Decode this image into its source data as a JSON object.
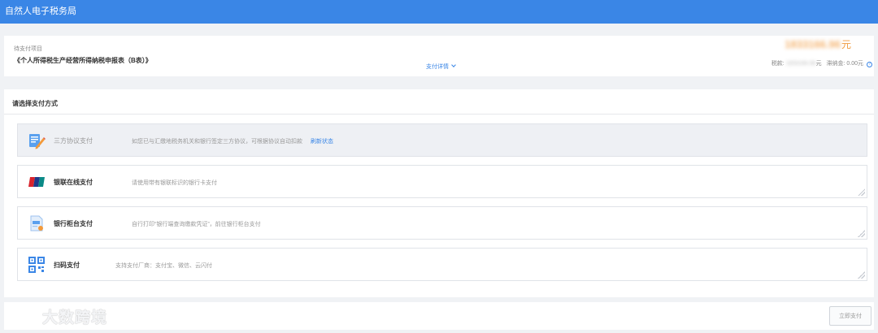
{
  "header": {
    "title": "自然人电子税务局"
  },
  "summary": {
    "pending_label": "待支付项目",
    "item_name": "《个人所得税生产经营所得纳税申报表（B表）》",
    "details_label": "支付详情",
    "amount_value": "1833166.96",
    "amount_unit": "元",
    "tax_label": "税款:",
    "tax_value": "1833166.96",
    "tax_unit": "元",
    "late_fee_label": "滞纳金:",
    "late_fee_value": "0.00元"
  },
  "methods": {
    "title": "请选择支付方式",
    "options": [
      {
        "name": "三方协议支付",
        "desc": "如您已与汇缴地税务机关和银行签定三方协议，可根据协议自动扣款",
        "link": "刷新状态",
        "icon": "pen-document-icon"
      },
      {
        "name": "银联在线支付",
        "desc": "请使用带有银联标识的银行卡支付",
        "icon": "unionpay-icon"
      },
      {
        "name": "银行柜台支付",
        "desc": "自行打印“银行端查询缴款凭证”，前往银行柜台支付",
        "icon": "bank-voucher-icon"
      },
      {
        "name": "扫码支付",
        "desc": "支持支付厂商：支付宝、微信、云闪付",
        "icon": "qr-code-icon"
      }
    ]
  },
  "footer": {
    "pay_button": "立即支付"
  },
  "watermark": {
    "text": "大数跨境"
  },
  "colors": {
    "primary": "#3a86e6",
    "amount": "#f19a3e",
    "background": "#f0f2f5"
  }
}
